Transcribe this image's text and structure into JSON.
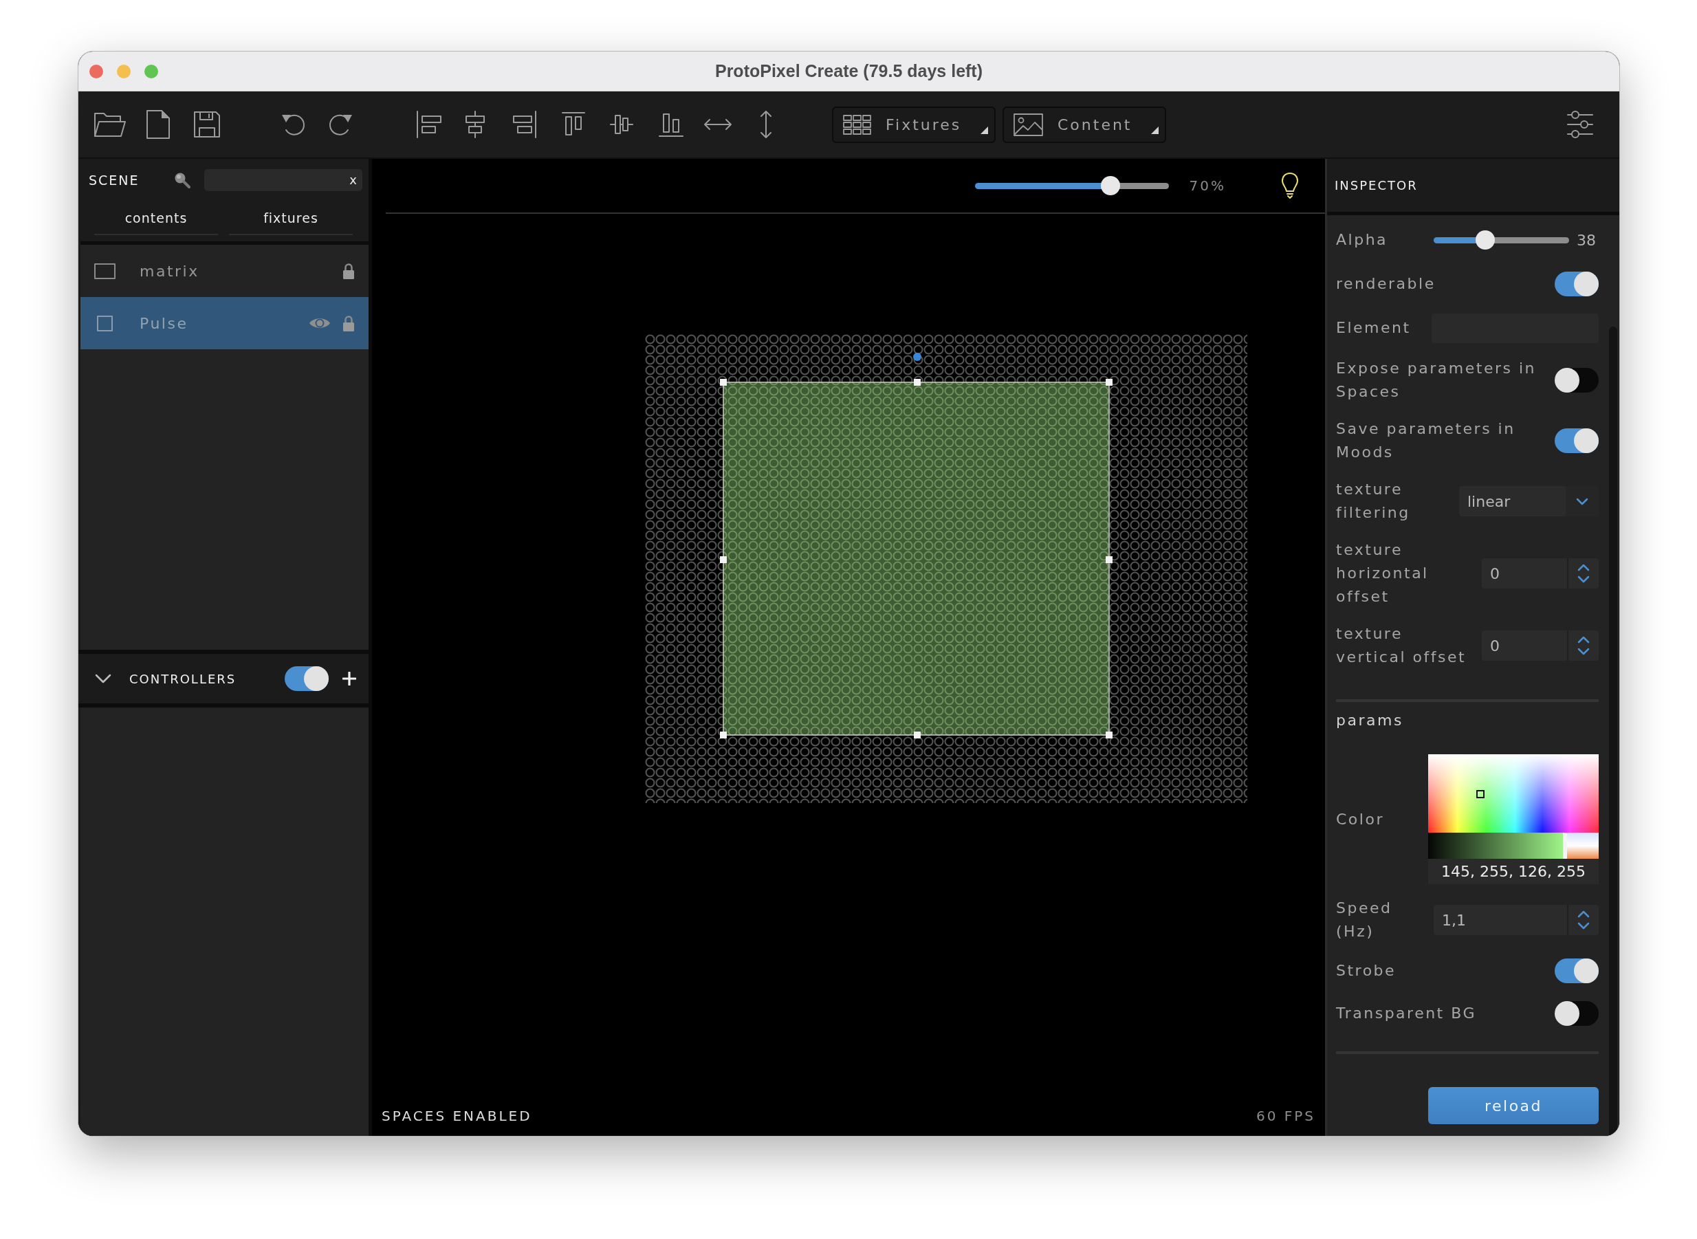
{
  "window": {
    "title": "ProtoPixel Create (79.5 days left)"
  },
  "toolbar": {
    "dropdowns": [
      {
        "label": "Fixtures"
      },
      {
        "label": "Content"
      }
    ]
  },
  "scene": {
    "title": "SCENE",
    "search": {
      "clear": "x"
    },
    "tabs": [
      {
        "label": "contents",
        "selected": false
      },
      {
        "label": "fixtures",
        "selected": false
      }
    ],
    "items": [
      {
        "kind": "fixture",
        "name": "matrix",
        "selected": false
      },
      {
        "kind": "content",
        "name": "Pulse",
        "selected": true
      }
    ]
  },
  "controllers": {
    "title": "CONTROLLERS",
    "expanded": true,
    "on": true
  },
  "canvas": {
    "zoom": {
      "level": 0.7,
      "reading": "70%"
    },
    "status": "SPACES ENABLED",
    "fps": "60 FPS"
  },
  "inspector": {
    "title": "INSPECTOR",
    "properties": [
      {
        "kind": "slider",
        "label": "Alpha",
        "level": 0.38,
        "reading": "38"
      },
      {
        "kind": "toggle",
        "label": "renderable",
        "on": true
      },
      {
        "kind": "text",
        "label": "Element"
      },
      {
        "kind": "toggle",
        "label": "Expose parameters in Spaces",
        "on": false
      },
      {
        "kind": "toggle",
        "label": "Save parameters in Moods",
        "on": true
      },
      {
        "kind": "select",
        "label": "texture filtering",
        "value": "linear"
      },
      {
        "kind": "number",
        "label": "texture horizontal offset",
        "value": "0"
      },
      {
        "kind": "number",
        "label": "texture vertical offset",
        "value": "0"
      }
    ],
    "params": {
      "title": "params",
      "items": [
        {
          "kind": "color",
          "label": "Color",
          "value": "145, 255, 126, 255"
        },
        {
          "kind": "number",
          "label": "Speed (Hz)",
          "value": "1,1"
        },
        {
          "kind": "toggle",
          "label": "Strobe",
          "on": true
        },
        {
          "kind": "toggle",
          "label": "Transparent BG",
          "on": false
        }
      ]
    },
    "reload_button": "reload"
  }
}
